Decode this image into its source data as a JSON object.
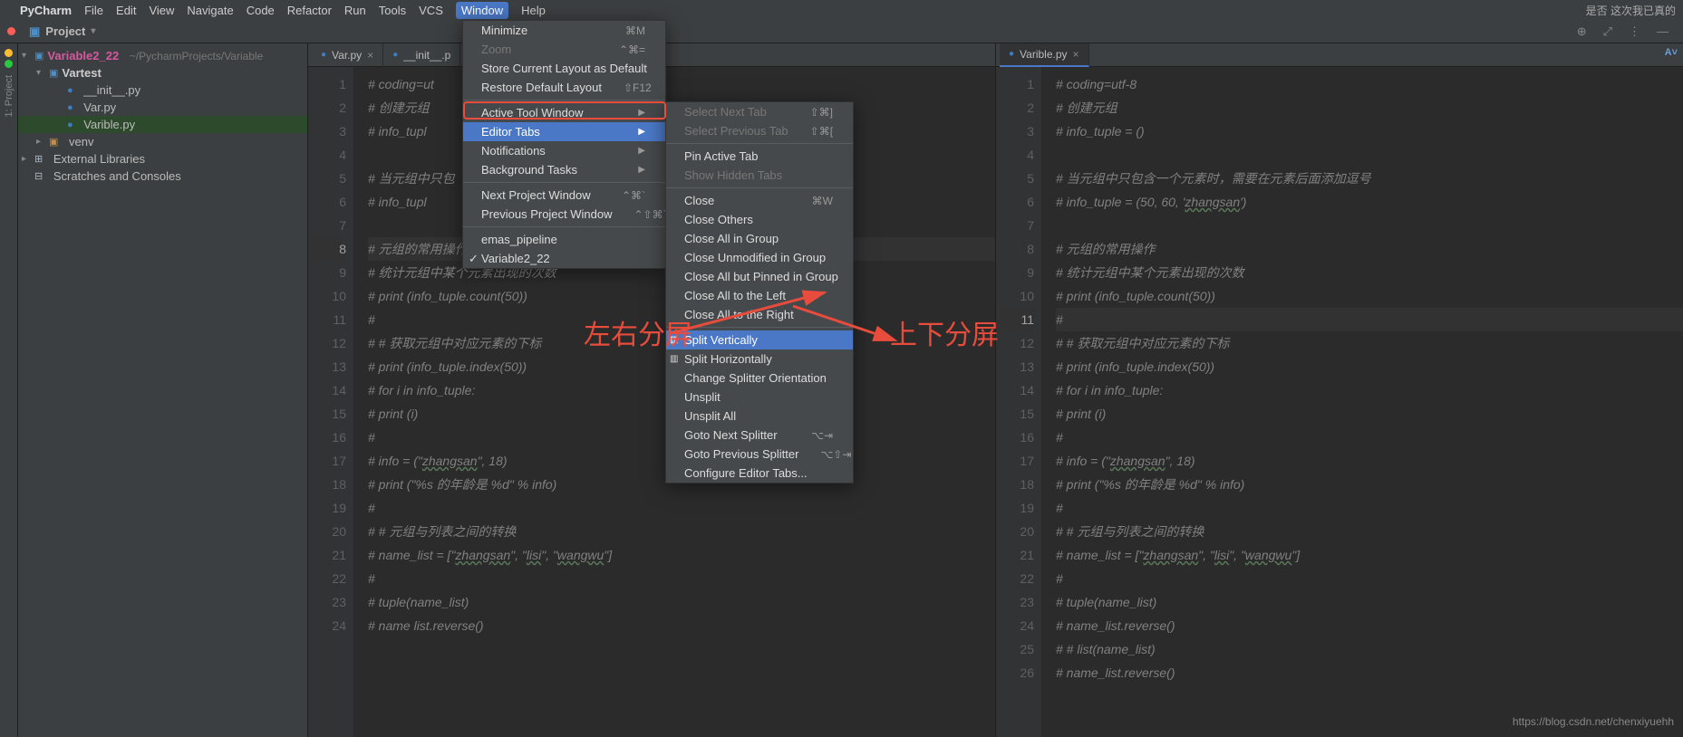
{
  "menubar": {
    "apple": "",
    "app": "PyCharm",
    "items": [
      "File",
      "Edit",
      "View",
      "Navigate",
      "Code",
      "Refactor",
      "Run",
      "Tools",
      "VCS",
      "Window",
      "Help"
    ],
    "active_index": 9,
    "right_text": "是否 这次我已真的"
  },
  "topbar": {
    "project_label": "Project",
    "icons": [
      "⊕",
      "⤢",
      "⋮",
      "—"
    ]
  },
  "tree": {
    "root": {
      "name": "Variable2_22",
      "path": "~/PycharmProjects/Variable"
    },
    "vartest": "Vartest",
    "files": [
      "__init__.py",
      "Var.py",
      "Varible.py"
    ],
    "venv": "venv",
    "ext": "External Libraries",
    "scratch": "Scratches and Consoles",
    "rail_label": "1: Project"
  },
  "left_pane": {
    "tabs": [
      {
        "name": "Var.py",
        "active": false
      },
      {
        "name": "__init__.p",
        "active": false
      }
    ],
    "lines": [
      "# coding=ut",
      "# 创建元组",
      "# info_tupl",
      "",
      "# 当元组中只包",
      "# info_tupl",
      "",
      "#  元组的常用操作",
      "#  统计元组中某个元素出现的次数",
      "# print (info_tuple.count(50))",
      "#",
      "# #  获取元组中对应元素的下标",
      "# print (info_tuple.index(50))",
      "# for i in info_tuple:",
      "#     print (i)",
      "#",
      "# info = (\"zhangsan\", 18)",
      "# print (\"%s 的年龄是 %d\" % info)",
      "#",
      "# #  元组与列表之间的转换",
      "# name_list = [\"zhangsan\", \"lisi\", \"wangwu\"]",
      "#",
      "# tuple(name_list)",
      "# name list.reverse()"
    ],
    "current_line": 8
  },
  "right_pane": {
    "tabs": [
      {
        "name": "Varible.py",
        "active": true
      }
    ],
    "lines": [
      "# coding=utf-8",
      "# 创建元组",
      "# info_tuple = ()",
      "",
      "# 当元组中只包含一个元素时，需要在元素后面添加逗号",
      "# info_tuple = (50, 60, 'zhangsan')",
      "",
      "#  元组的常用操作",
      "#  统计元组中某个元素出现的次数",
      "# print (info_tuple.count(50))",
      "#",
      "# #  获取元组中对应元素的下标",
      "# print (info_tuple.index(50))",
      "# for i in info_tuple:",
      "#     print (i)",
      "#",
      "# info = (\"zhangsan\", 18)",
      "# print (\"%s 的年龄是 %d\" % info)",
      "#",
      "# #  元组与列表之间的转换",
      "# name_list = [\"zhangsan\", \"lisi\", \"wangwu\"]",
      "#",
      "# tuple(name_list)",
      "# name_list.reverse()",
      "# # list(name_list)",
      "# name_list.reverse()"
    ],
    "current_line": 11
  },
  "window_menu": {
    "items": [
      {
        "label": "Minimize",
        "shortcut": "⌘M"
      },
      {
        "label": "Zoom",
        "shortcut": "⌃⌘=",
        "dis": true
      },
      {
        "label": "Store Current Layout as Default"
      },
      {
        "label": "Restore Default Layout",
        "shortcut": "⇧F12"
      },
      {
        "sep": true
      },
      {
        "label": "Active Tool Window",
        "arrow": true
      },
      {
        "label": "Editor Tabs",
        "arrow": true,
        "sel": true
      },
      {
        "label": "Notifications",
        "arrow": true
      },
      {
        "label": "Background Tasks",
        "arrow": true
      },
      {
        "sep": true
      },
      {
        "label": "Next Project Window",
        "shortcut": "⌃⌘`"
      },
      {
        "label": "Previous Project Window",
        "shortcut": "⌃⇧⌘`"
      },
      {
        "sep": true
      },
      {
        "label": "emas_pipeline"
      },
      {
        "label": "Variable2_22",
        "checked": true
      }
    ]
  },
  "editor_tabs_menu": {
    "items": [
      {
        "label": "Select Next Tab",
        "shortcut": "⇧⌘]",
        "dis": true
      },
      {
        "label": "Select Previous Tab",
        "shortcut": "⇧⌘[",
        "dis": true
      },
      {
        "sep": true
      },
      {
        "label": "Pin Active Tab"
      },
      {
        "label": "Show Hidden Tabs",
        "dis": true
      },
      {
        "sep": true
      },
      {
        "label": "Close",
        "shortcut": "⌘W"
      },
      {
        "label": "Close Others"
      },
      {
        "label": "Close All in Group"
      },
      {
        "label": "Close Unmodified in Group"
      },
      {
        "label": "Close All but Pinned in Group"
      },
      {
        "label": "Close All to the Left"
      },
      {
        "label": "Close All to the Right"
      },
      {
        "sep": true
      },
      {
        "label": "Split Vertically",
        "sel": true,
        "icon": true
      },
      {
        "label": "Split Horizontally",
        "icon": true
      },
      {
        "label": "Change Splitter Orientation"
      },
      {
        "label": "Unsplit"
      },
      {
        "label": "Unsplit All"
      },
      {
        "label": "Goto Next Splitter",
        "shortcut": "⌥⇥"
      },
      {
        "label": "Goto Previous Splitter",
        "shortcut": "⌥⇧⇥"
      },
      {
        "label": "Configure Editor Tabs..."
      }
    ]
  },
  "annotations": {
    "left": "左右分屏",
    "right": "上下分屏"
  },
  "watermark": "https://blog.csdn.net/chenxiyuehh"
}
